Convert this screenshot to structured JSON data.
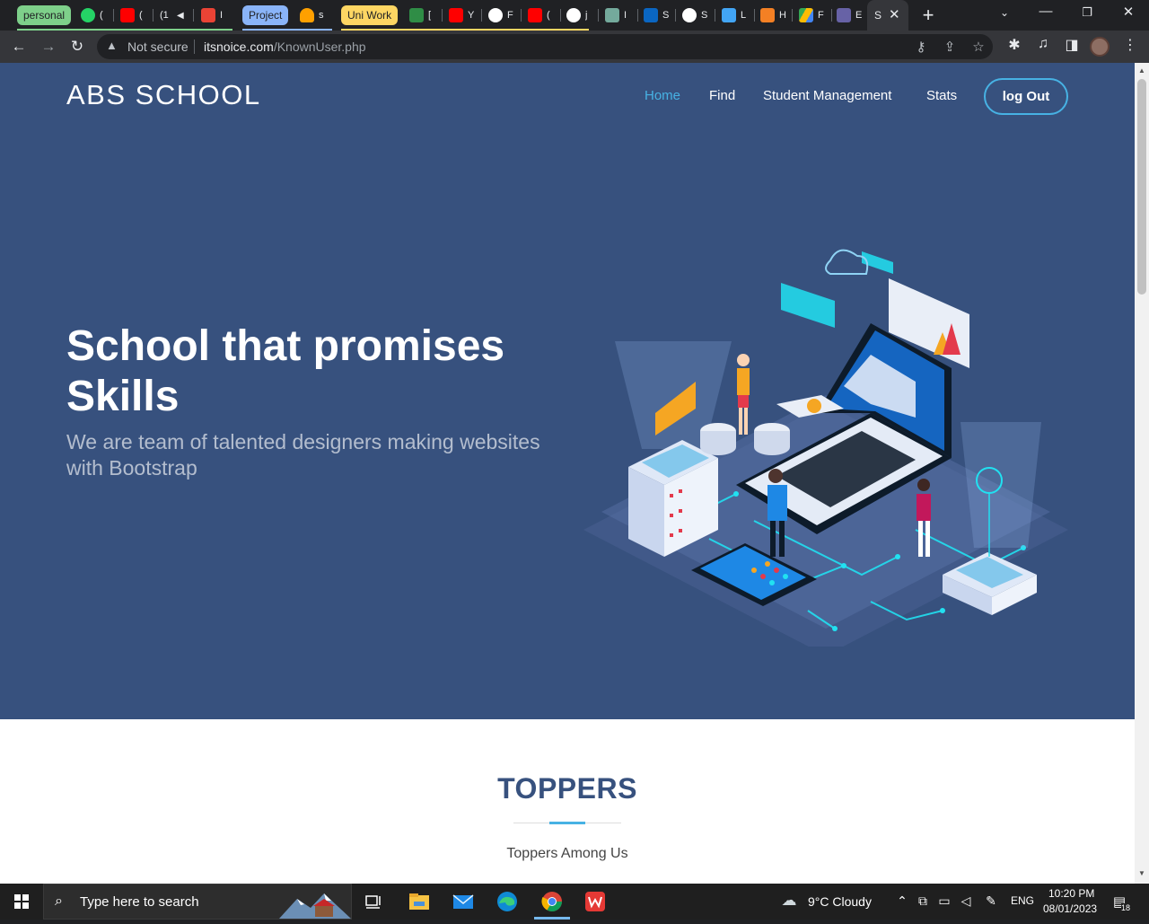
{
  "tab_strip": {
    "groups": [
      {
        "label": "personal",
        "color": "#7ed08a"
      },
      {
        "label": "Project",
        "color": "#8ab4f8"
      },
      {
        "label": "Uni Work",
        "color": "#fdd663"
      }
    ],
    "tabs": [
      {
        "icon": "whatsapp-icon",
        "title": "(",
        "color": "#25d366"
      },
      {
        "icon": "youtube-icon",
        "title": "(",
        "color": "#ff0000"
      },
      {
        "icon": "youtube-icon",
        "title": "(1",
        "color": "#ff0000"
      },
      {
        "icon": "gmail-icon",
        "title": "I",
        "color": "#ea4335"
      },
      {
        "icon": "firebase-icon",
        "title": "s",
        "color": "#ffa000"
      },
      {
        "icon": "geeksforgeeks-icon",
        "title": "[",
        "color": "#2f8d46"
      },
      {
        "icon": "youtube-icon",
        "title": "Y",
        "color": "#ff0000"
      },
      {
        "icon": "github-icon",
        "title": "F",
        "color": "#ffffff"
      },
      {
        "icon": "youtube-icon",
        "title": "(",
        "color": "#ff0000"
      },
      {
        "icon": "github-icon",
        "title": "j",
        "color": "#ffffff"
      },
      {
        "icon": "chatgpt-icon",
        "title": "I",
        "color": "#74aa9c"
      },
      {
        "icon": "linkedin-icon",
        "title": "S",
        "color": "#0a66c2"
      },
      {
        "icon": "github-icon",
        "title": "S",
        "color": "#ffffff"
      },
      {
        "icon": "flutter-icon",
        "title": "L",
        "color": "#42a5f5"
      },
      {
        "icon": "stackoverflow-icon",
        "title": "H",
        "color": "#f48024"
      },
      {
        "icon": "drive-icon",
        "title": "F",
        "color": "#34a853"
      },
      {
        "icon": "heroku-icon",
        "title": "E",
        "color": "#6762a6"
      }
    ],
    "active_tab": {
      "title": "S"
    }
  },
  "address_bar": {
    "security_label": "Not secure",
    "url_host": "itsnoice.com",
    "url_path": "/KnownUser.php"
  },
  "site": {
    "brand": "ABS SCHOOL",
    "nav": [
      {
        "label": "Home",
        "active": true
      },
      {
        "label": "Find",
        "active": false
      },
      {
        "label": "Student Management",
        "active": false
      },
      {
        "label": "Stats",
        "active": false
      }
    ],
    "logout_label": "log Out",
    "hero": {
      "title": "School that promises Skills",
      "subtitle": "We are team of talented designers making websites with Bootstrap"
    },
    "toppers": {
      "title": "TOPPERS",
      "subtitle": "Toppers Among Us"
    },
    "colors": {
      "hero_bg": "#37517e",
      "accent": "#47b2e4"
    }
  },
  "taskbar": {
    "search_placeholder": "Type here to search",
    "weather": "9°C  Cloudy",
    "language": "ENG",
    "time": "10:20 PM",
    "date": "08/01/2023",
    "notification_count": "18"
  }
}
